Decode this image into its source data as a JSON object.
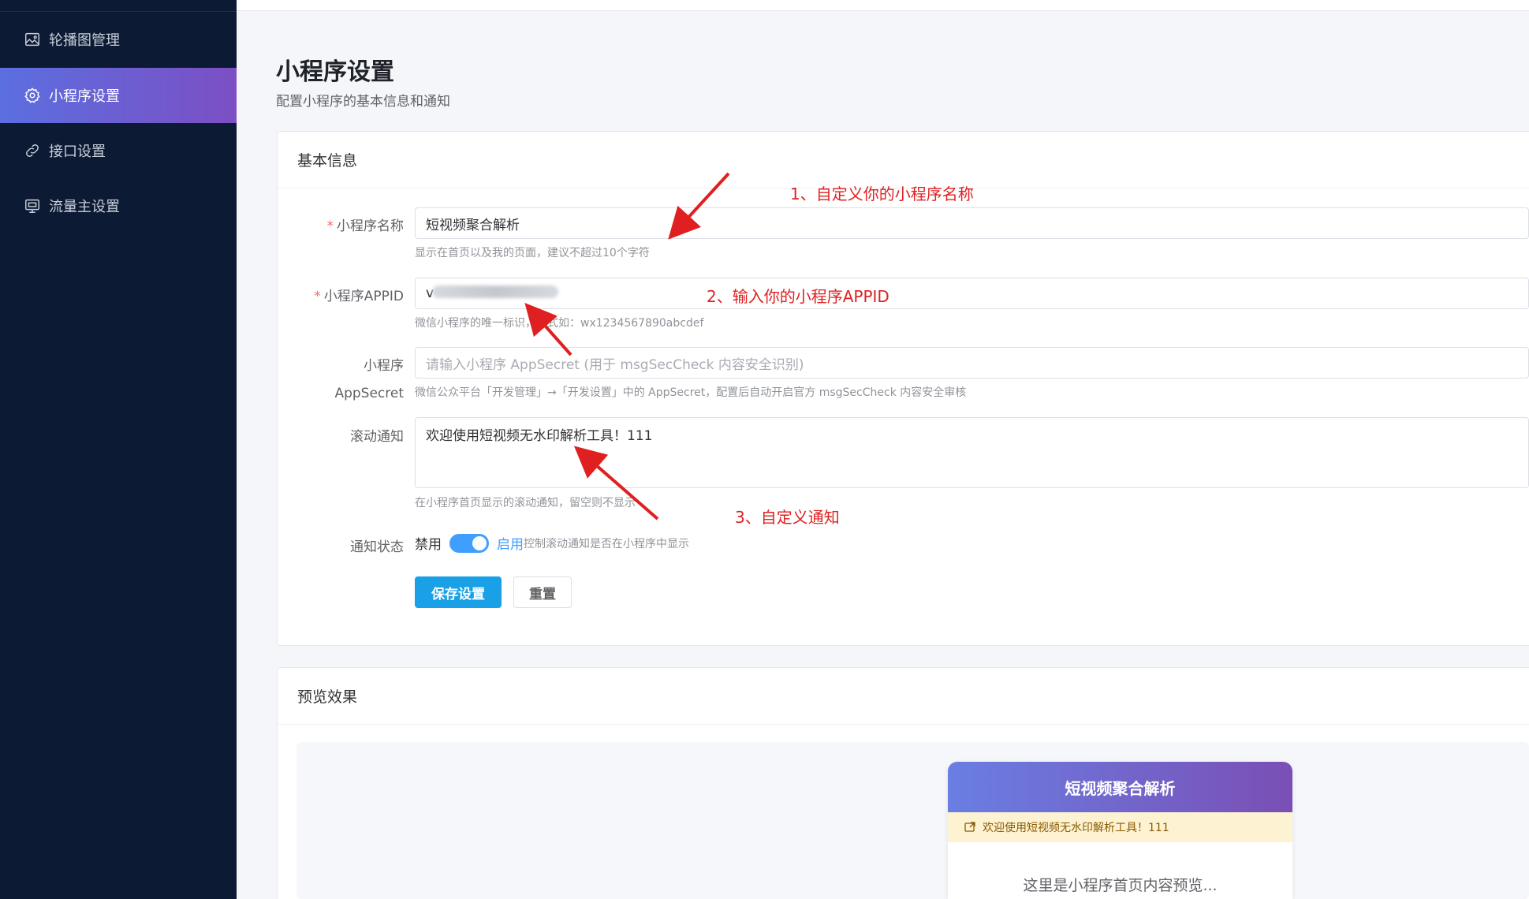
{
  "sidebar": {
    "items": [
      {
        "label": "轮播图管理",
        "icon": "image-icon"
      },
      {
        "label": "小程序设置",
        "icon": "gear-icon"
      },
      {
        "label": "接口设置",
        "icon": "link-icon"
      },
      {
        "label": "流量主设置",
        "icon": "monitor-icon"
      }
    ],
    "active_index": 1
  },
  "page": {
    "title": "小程序设置",
    "subtitle": "配置小程序的基本信息和通知"
  },
  "basic": {
    "header": "基本信息",
    "name_label": "小程序名称",
    "name_value": "短视频聚合解析",
    "name_hint": "显示在首页以及我的页面，建议不超过10个字符",
    "appid_label": "小程序APPID",
    "appid_visible_prefix": "v",
    "appid_hint": "微信小程序的唯一标识，格式如：wx1234567890abcdef",
    "secret_label_1": "小程序",
    "secret_label_2": "AppSecret",
    "secret_placeholder": "请输入小程序 AppSecret (用于 msgSecCheck 内容安全识别)",
    "secret_hint": "微信公众平台「开发管理」→「开发设置」中的 AppSecret，配置后自动开启官方 msgSecCheck 内容安全审核",
    "notice_label": "滚动通知",
    "notice_value": "欢迎使用短视频无水印解析工具！111",
    "notice_hint": "在小程序首页显示的滚动通知，留空则不显示",
    "status_label": "通知状态",
    "status_off": "禁用",
    "status_on": "启用",
    "status_hint": "控制滚动通知是否在小程序中显示",
    "status_enabled": true,
    "save_button": "保存设置",
    "reset_button": "重置"
  },
  "annotations": {
    "a1": "1、自定义你的小程序名称",
    "a2": "2、输入你的小程序APPID",
    "a3": "3、自定义通知",
    "color": "#e02020"
  },
  "preview": {
    "header": "预览效果",
    "app_title": "短视频聚合解析",
    "notice": "欢迎使用短视频无水印解析工具！111",
    "body": "这里是小程序首页内容预览..."
  },
  "colors": {
    "sidebar_bg": "#0d1a33",
    "active_gradient_start": "#5b6fe0",
    "active_gradient_end": "#7c4fc4",
    "primary_button": "#1aa0e6",
    "switch_on": "#409eff",
    "required": "#f56c6c"
  }
}
